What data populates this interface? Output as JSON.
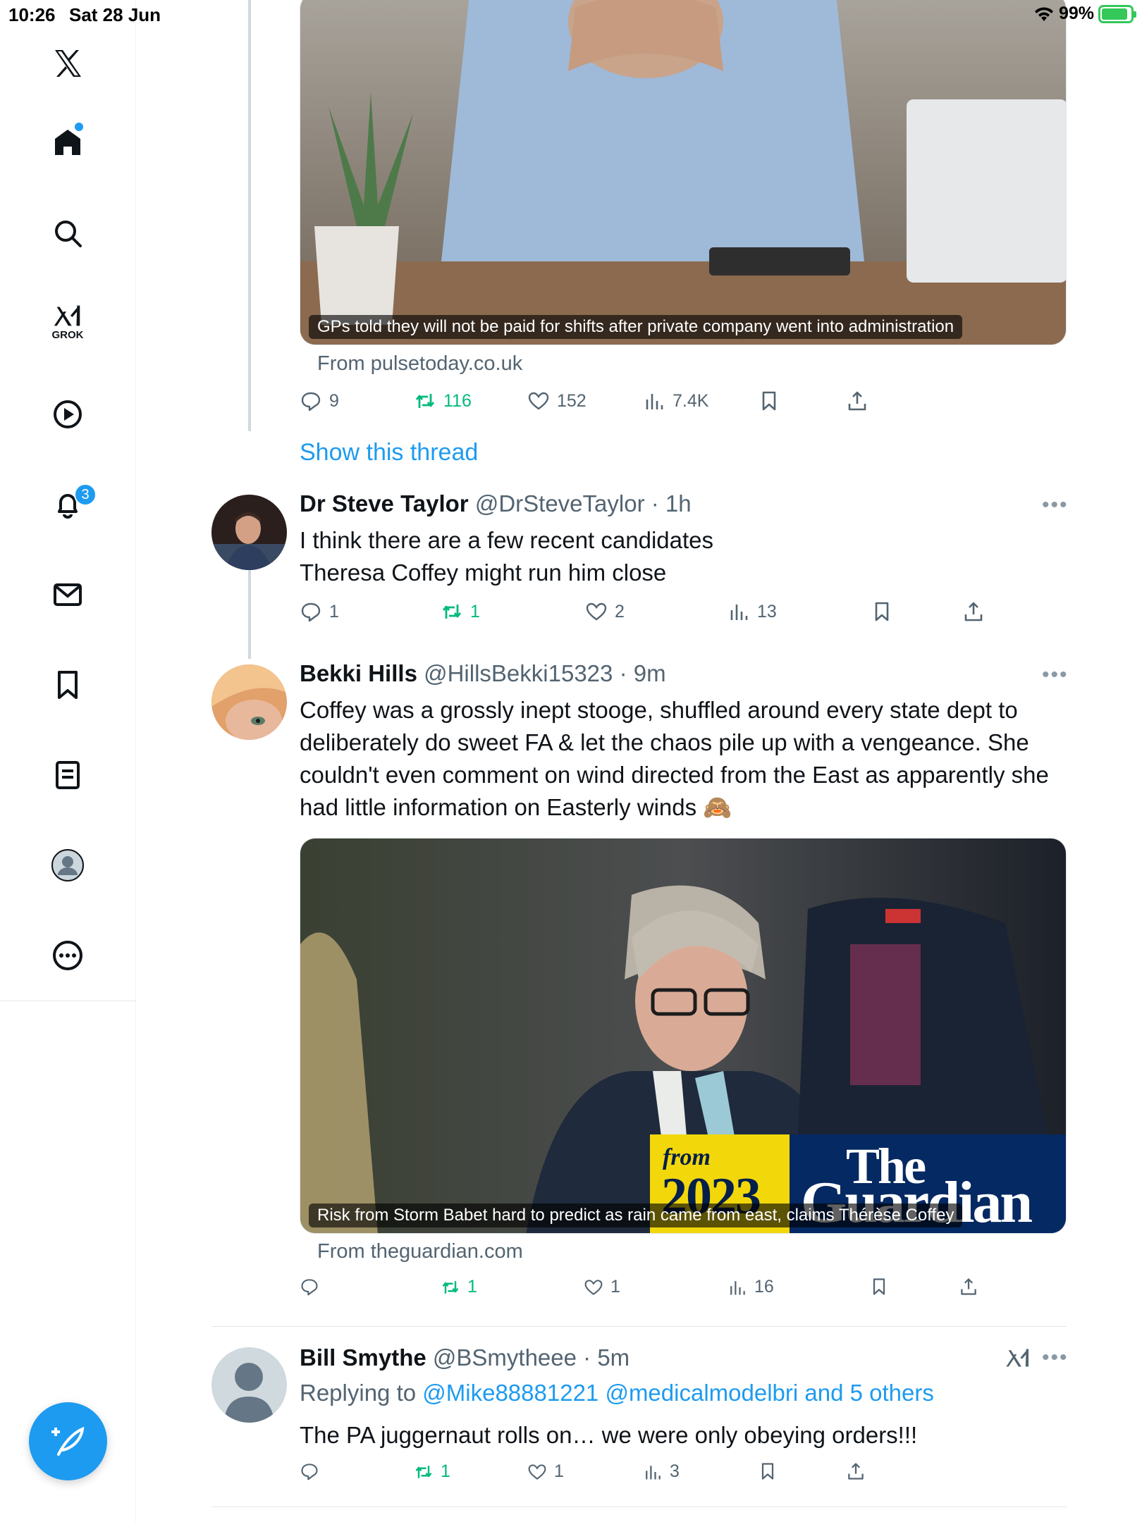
{
  "status_bar": {
    "time": "10:26",
    "date": "Sat 28 Jun",
    "battery": "99%"
  },
  "sidebar": {
    "notifications_badge": "3",
    "grok_label": "GROK"
  },
  "tweet0": {
    "media_caption": "GPs told they will not be paid for shifts after private company went into administration",
    "source": "From pulsetoday.co.uk",
    "replies": "9",
    "retweets": "116",
    "likes": "152",
    "views": "7.4K",
    "show_thread": "Show this thread"
  },
  "tweet1": {
    "name": "Dr Steve Taylor",
    "handle": "@DrSteveTaylor",
    "time": "· 1h",
    "text_line1": "I think there are a few recent candidates",
    "text_line2": "Theresa Coffey might run him close",
    "replies": "1",
    "retweets": "1",
    "likes": "2",
    "views": "13"
  },
  "tweet2": {
    "name": "Bekki Hills",
    "handle": "@HillsBekki15323",
    "time": "· 9m",
    "text": "Coffey was a grossly inept stooge, shuffled around every state dept to deliberately do sweet FA & let the chaos pile up with a vengeance. She couldn't even comment on wind directed from the East as apparently she had little information on Easterly winds 🙈",
    "media_caption": "Risk from Storm Babet hard to predict as rain came from east, claims Thérèse Coffey",
    "banner_from": "from",
    "banner_year": "2023",
    "banner_brand_line1": "The",
    "banner_brand_line2": "Guardian",
    "source": "From theguardian.com",
    "retweets": "1",
    "likes": "1",
    "views": "16"
  },
  "tweet3": {
    "name": "Bill Smythe",
    "handle": "@BSmytheee",
    "time": "· 5m",
    "replying_prefix": "Replying to",
    "replying_links": "@Mike88881221 @medicalmodelbri and 5 others",
    "text": "The PA  juggernaut rolls on… we were only obeying orders!!!",
    "retweets": "1",
    "likes": "1",
    "views": "3"
  },
  "colors": {
    "accent": "#1d9bf0",
    "retweet": "#00ba7c",
    "muted": "#536471"
  }
}
